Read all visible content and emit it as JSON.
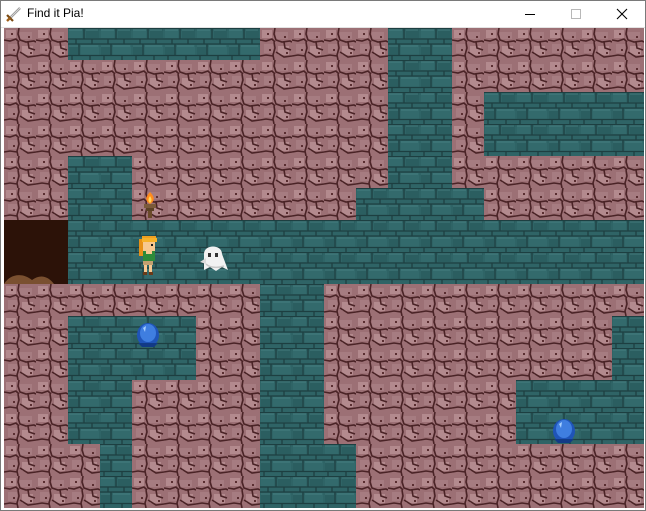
{
  "window": {
    "title": "Find it Pia!",
    "app_icon": "sword-icon",
    "controls": [
      "minimize-icon",
      "maximize-icon",
      "close-icon"
    ]
  },
  "colors": {
    "rock": "#9c7075",
    "rock_light": "#b48c90",
    "rock_crack": "#4a2326",
    "floor": "#2f6466",
    "floor_light": "#3e7a7c",
    "floor_line": "#1d3f41",
    "exit": "#2c1208"
  },
  "sprites": [
    "torch-icon",
    "player-girl",
    "ghost-enemy",
    "blue-gem",
    "blue-gem"
  ]
}
